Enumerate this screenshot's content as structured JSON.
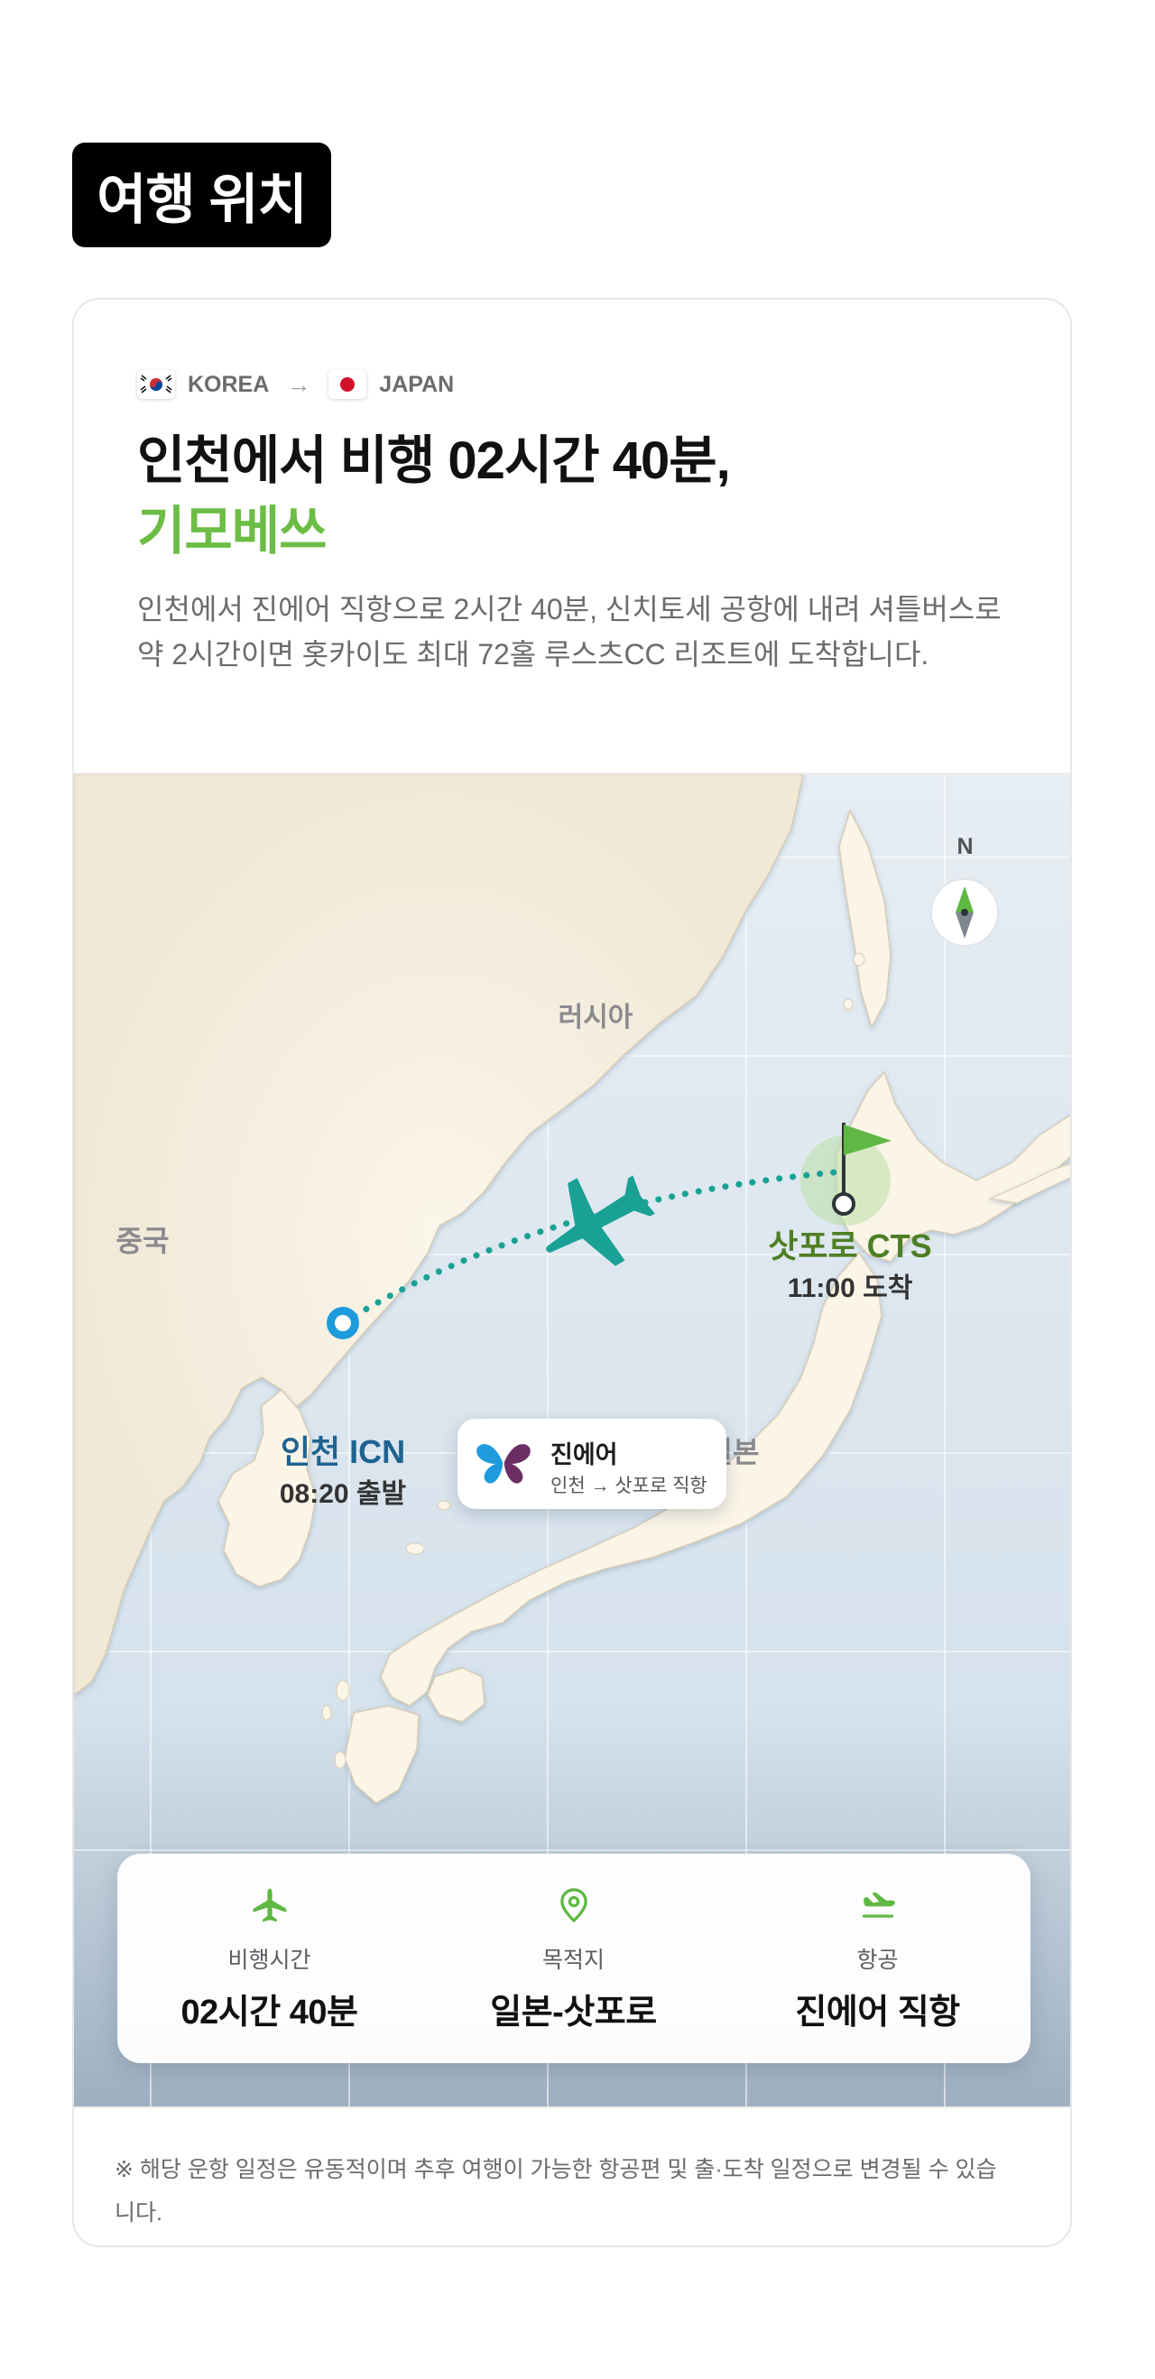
{
  "section_title": "여행 위치",
  "route": {
    "from_country": "KOREA",
    "arrow": "→",
    "to_country": "JAPAN"
  },
  "headline": {
    "line1": "인천에서 비행 02시간 40분,",
    "line2": "기모베쓰"
  },
  "description": "인천에서 진에어 직항으로 2시간 40분, 신치토세 공항에 내려 셔틀버스로 약 2시간이면 홋카이도 최대 72홀 루스츠CC 리조트에 도착합니다.",
  "map": {
    "compass_label": "N",
    "regions": {
      "russia": "러시아",
      "china": "중국",
      "japan": "일본"
    },
    "airline_pill": {
      "name": "진에어",
      "route": "인천 → 삿포로 직항"
    },
    "origin": {
      "name": "인천 ICN",
      "time": "08:20 출발"
    },
    "destination": {
      "name": "삿포로 CTS",
      "time": "11:00 도착"
    },
    "icons": [
      "compass-icon",
      "jinair-logo-icon",
      "airplane-icon",
      "origin-pin-icon",
      "destination-flag-icon"
    ]
  },
  "info": {
    "flight_time": {
      "label": "비행시간",
      "value": "02시간 40분",
      "icon": "airplane-icon"
    },
    "destination": {
      "label": "목적지",
      "value": "일본-삿포로",
      "icon": "location-pin-icon"
    },
    "airline": {
      "label": "항공",
      "value": "진에어 직항",
      "icon": "landing-plane-icon"
    }
  },
  "footnote": "※ 해당 운항 일정은 유동적이며 추후 여행이 가능한 항공편 및 출·도착 일정으로 변경될 수 있습니다.",
  "colors": {
    "accent_green": "#6cbd45",
    "route_teal": "#1aa195",
    "origin_blue": "#1e9bdc",
    "dest_green": "#4e7f24"
  }
}
